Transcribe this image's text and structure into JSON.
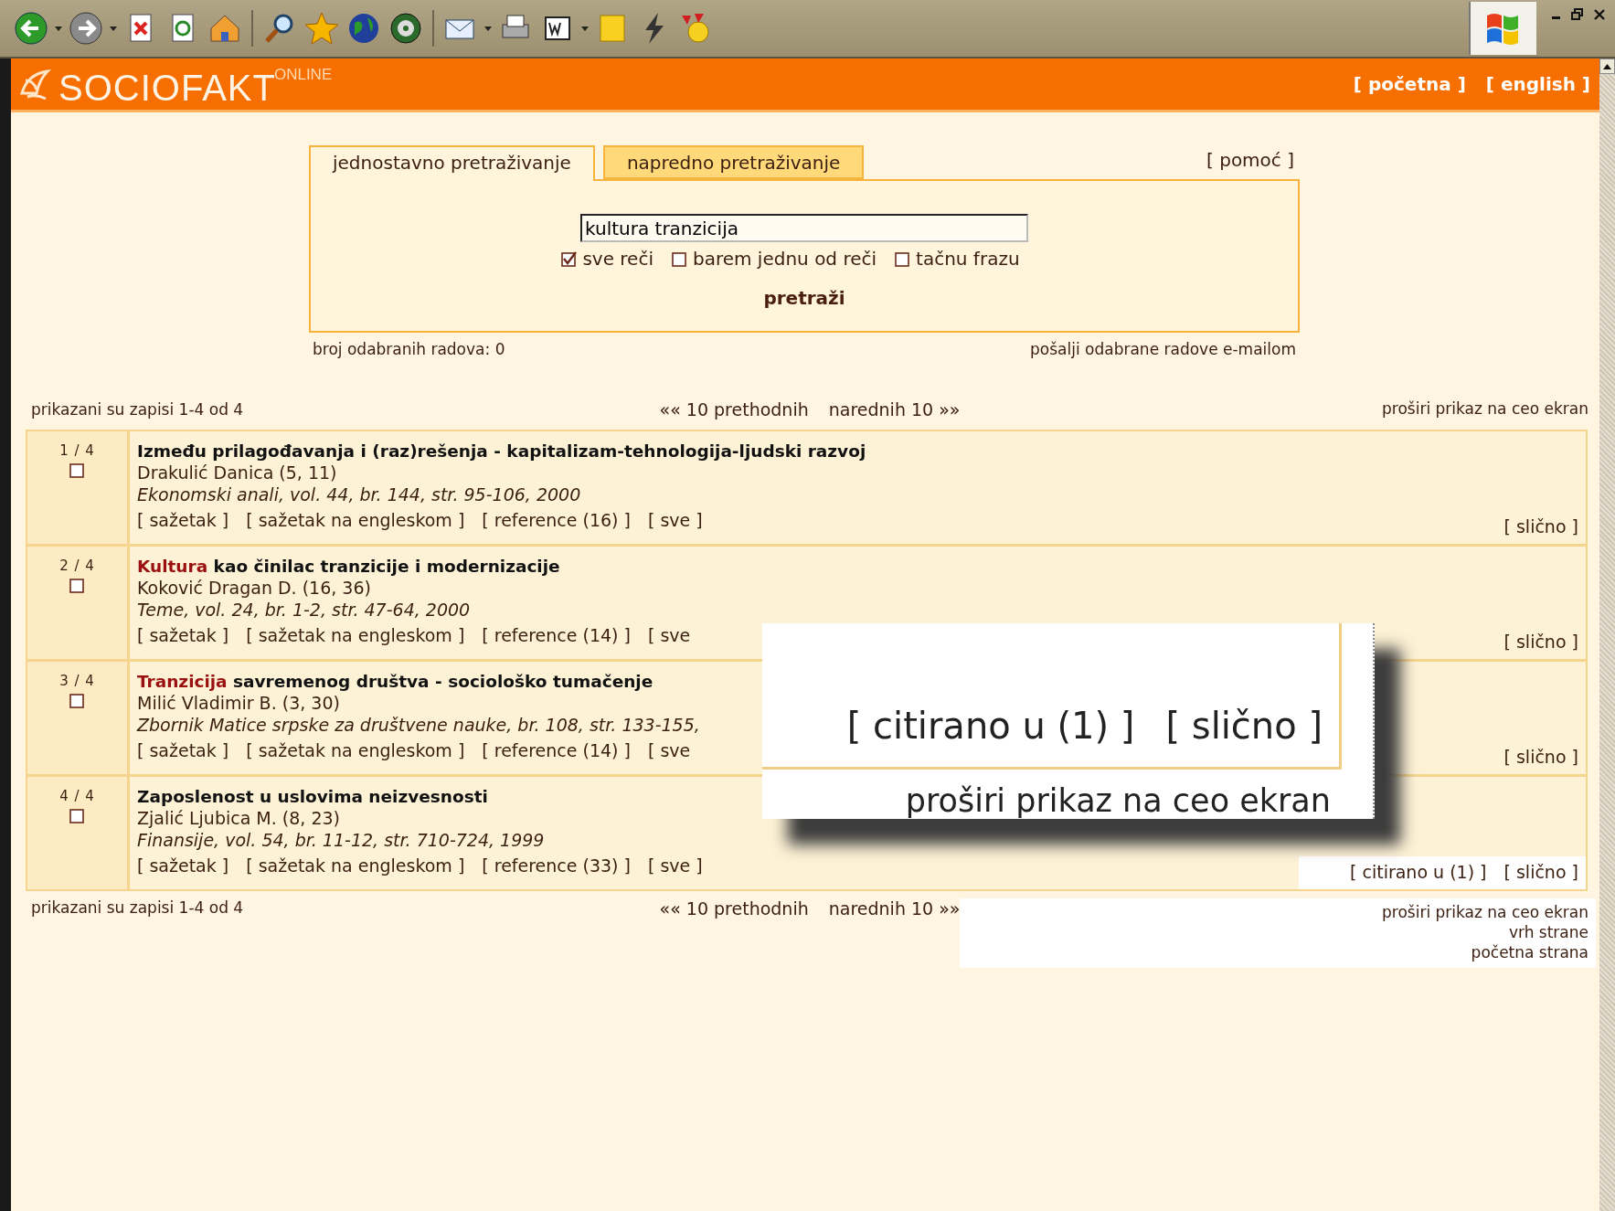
{
  "header": {
    "logo": "SOCIOFAKT",
    "logo_sup": "ONLINE",
    "links": [
      "[ početna ]",
      "[ english ]"
    ]
  },
  "search": {
    "tabs": [
      {
        "label": "jednostavno pretraživanje",
        "selected": true
      },
      {
        "label": "napredno pretraživanje",
        "selected": false
      }
    ],
    "help": "[ pomoć ]",
    "query": "kultura tranzicija",
    "options": [
      {
        "label": "sve reči",
        "checked": true
      },
      {
        "label": "barem jednu od reči",
        "checked": false
      },
      {
        "label": "tačnu frazu",
        "checked": false
      }
    ],
    "submit": "pretraži",
    "selected_count": "broj odabranih radova: 0",
    "email_link": "pošalji odabrane radove e-mailom"
  },
  "results": {
    "summary": "prikazani su zapisi 1-4 od 4",
    "prev": "«« 10 prethodnih",
    "next": "narednih 10 »»",
    "expand": "proširi prikaz na ceo ekran",
    "rows": [
      {
        "index": "1 / 4",
        "checked": false,
        "title_parts": [
          {
            "text": "Između prilagođavanja i (raz)rešenja - kapitalizam-tehnologija-ljudski razvoj",
            "highlight": false
          }
        ],
        "author": "Drakulić Danica (5, 11)",
        "source": "Ekonomski anali, vol. 44, br. 144, str. 95-106, 2000",
        "links": [
          "[ sažetak ]",
          "[ sažetak na engleskom ]",
          "[ reference (16) ]",
          "[ sve ]"
        ],
        "right_links": [
          "[ slično ]"
        ],
        "highlighted": false
      },
      {
        "index": "2 / 4",
        "checked": false,
        "title_parts": [
          {
            "text": "Kultura",
            "highlight": true
          },
          {
            "text": " kao činilac tranzicije i modernizacije",
            "highlight": false
          }
        ],
        "author": "Koković Dragan D. (16, 36)",
        "source": "Teme, vol. 24, br. 1-2, str. 47-64, 2000",
        "links": [
          "[ sažetak ]",
          "[ sažetak na engleskom ]",
          "[ reference (14) ]",
          "[ sve"
        ],
        "right_links": [
          "[ slično ]"
        ],
        "highlighted": false
      },
      {
        "index": "3 / 4",
        "checked": false,
        "title_parts": [
          {
            "text": "Tranzicija",
            "highlight": true
          },
          {
            "text": " savremenog društva - sociološko tumačenje",
            "highlight": false
          }
        ],
        "author": "Milić Vladimir B. (3, 30)",
        "source": "Zbornik Matice srpske za društvene nauke, br. 108, str. 133-155,",
        "links": [
          "[ sažetak ]",
          "[ sažetak na engleskom ]",
          "[ reference (14) ]",
          "[ sve"
        ],
        "right_links": [
          "[ slično ]"
        ],
        "highlighted": false
      },
      {
        "index": "4 / 4",
        "checked": false,
        "title_parts": [
          {
            "text": "Zaposlenost u uslovima neizvesnosti",
            "highlight": false
          }
        ],
        "author": "Zjalić Ljubica M. (8, 23)",
        "source": "Finansije, vol. 54, br. 11-12, str. 710-724, 1999",
        "links": [
          "[ sažetak ]",
          "[ sažetak na engleskom ]",
          "[ reference (33) ]",
          "[ sve ]"
        ],
        "right_links": [
          "[ citirano u (1) ]",
          "[ slično ]"
        ],
        "highlighted": true
      }
    ]
  },
  "footer": {
    "summary": "prikazani su zapisi 1-4 od 4",
    "prev": "«« 10 prethodnih",
    "next": "narednih 10 »»",
    "links": [
      "proširi prikaz na ceo ekran",
      "vrh strane",
      "početna strana"
    ],
    "highlighted": true
  },
  "callout": {
    "links": [
      "[ citirano u (1) ]",
      "[ slično ]"
    ],
    "caption": "proširi prikaz na ceo ekran"
  }
}
